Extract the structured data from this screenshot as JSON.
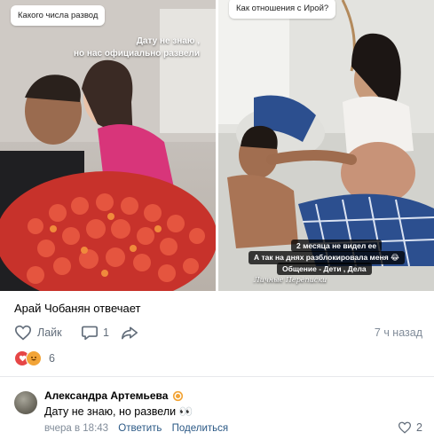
{
  "post": {
    "left_photo": {
      "question": "Какого числа развод",
      "overlay_line1": "Дату не знаю ,",
      "overlay_line2": "но нас официально развели"
    },
    "right_photo": {
      "question": "Как отношения с Ирой?",
      "caption1": "2 месяца не видел ее",
      "caption2": "А так на днях разблокировала меня 😂",
      "caption3": "Общение - Дети , Дела",
      "watermark": "Личные Переписки"
    },
    "author_line": "Арай Чобанян отвечает",
    "actions": {
      "like_label": "Лайк",
      "comment_count": "1",
      "time": "7 ч назад"
    },
    "reactions": {
      "count": "6"
    }
  },
  "comment": {
    "author": "Александра Артемьева",
    "text": "Дату не знаю, но развели 👀",
    "time": "вчера в 18:43",
    "reply_label": "Ответить",
    "share_label": "Поделиться",
    "like_count": "2"
  },
  "colors": {
    "link": "#2a5885",
    "secondary": "#818c99",
    "icon": "#626d7a",
    "heart_reaction": "#e64646",
    "lol_reaction": "#f2a437"
  }
}
